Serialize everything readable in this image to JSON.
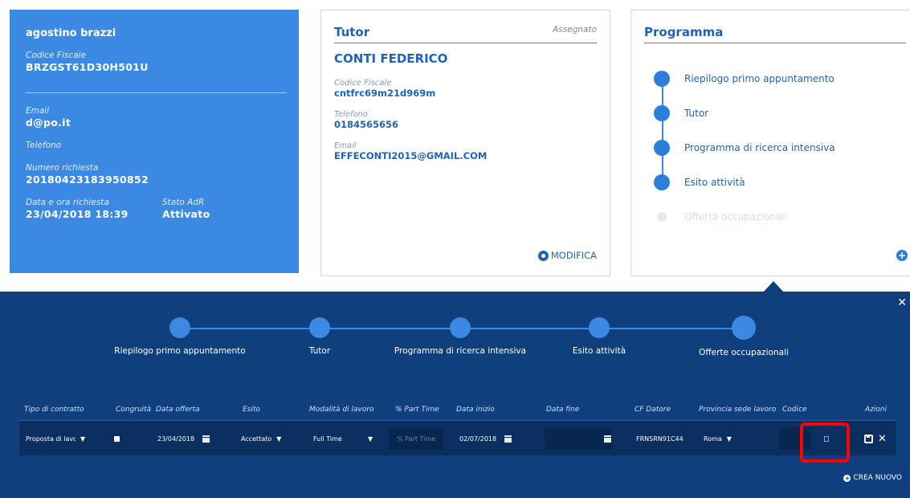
{
  "user": {
    "name": "agostino brazzi",
    "cf_label": "Codice Fiscale",
    "cf_value": "BRZGST61D30H501U",
    "email_label": "Email",
    "email_value": "d@po.it",
    "phone_label": "Telefono",
    "request_num_label": "Numero richiesta",
    "request_num_value": "20180423183950852",
    "date_label": "Data e ora richiesta",
    "date_value": "23/04/2018 18:39",
    "state_label": "Stato AdR",
    "state_value": "Attivato"
  },
  "tutor": {
    "title": "Tutor",
    "status": "Assegnato",
    "name": "CONTI FEDERICO",
    "cf_label": "Codice Fiscale",
    "cf_value": "cntfrc69m21d969m",
    "phone_label": "Telefono",
    "phone_value": "0184565656",
    "email_label": "Email",
    "email_value": "EFFECONTI2015@GMAIL.COM",
    "edit_label": "MODIFICA"
  },
  "programma": {
    "title": "Programma",
    "items": [
      {
        "label": "Riepilogo primo appuntamento",
        "active": true
      },
      {
        "label": "Tutor",
        "active": true
      },
      {
        "label": "Programma di ricerca intensiva",
        "active": true
      },
      {
        "label": "Esito attività",
        "active": true
      },
      {
        "label": "Offerta occupazionali",
        "active": false
      }
    ]
  },
  "stepper": {
    "steps": [
      "Riepilogo primo appuntamento",
      "Tutor",
      "Programma di ricerca intensiva",
      "Esito attività",
      "Offerte occupazionali"
    ]
  },
  "table": {
    "headers": {
      "tipo_contratto": "Tipo di contratto",
      "congruita": "Congruità",
      "data_offerta": "Data offerta",
      "esito": "Esito",
      "modalita": "Modalità di lavoro",
      "part_time": "% Part Time",
      "data_inizio": "Data inizio",
      "data_fine": "Data fine",
      "cf_datore": "CF Datore",
      "provincia": "Provincia sede lavoro",
      "codice": "Codice",
      "azioni": "Azioni"
    },
    "row": {
      "tipo_contratto": "Proposta di lavoro",
      "data_offerta": "23/04/2018",
      "esito": "Accettato",
      "modalita": "Full Time",
      "part_time_placeholder": "% Part Time",
      "data_inizio": "02/07/2018",
      "data_fine": "",
      "cf_datore": "FRNSRN91C44",
      "provincia": "Roma"
    }
  },
  "crea_nuovo": "CREA NUOVO",
  "colors": {
    "primary": "#3b89e2",
    "panel": "#0f3f7d",
    "row": "#0a2f60",
    "highlight": "#ff0000"
  }
}
